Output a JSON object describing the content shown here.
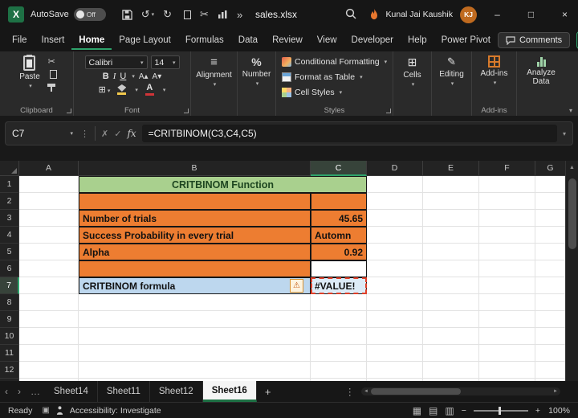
{
  "titlebar": {
    "autosave_label": "AutoSave",
    "autosave_state": "Off",
    "filename": "sales.xlsx",
    "user_name": "Kunal Jai Kaushik",
    "user_initials": "KJ"
  },
  "menubar": {
    "tabs": [
      {
        "label": "File"
      },
      {
        "label": "Insert"
      },
      {
        "label": "Home",
        "active": true
      },
      {
        "label": "Page Layout"
      },
      {
        "label": "Formulas"
      },
      {
        "label": "Data"
      },
      {
        "label": "Review"
      },
      {
        "label": "View"
      },
      {
        "label": "Developer"
      },
      {
        "label": "Help"
      },
      {
        "label": "Power Pivot"
      }
    ],
    "comments_label": "Comments"
  },
  "ribbon": {
    "paste": "Paste",
    "clipboard_group": "Clipboard",
    "font_name": "Calibri",
    "font_size": "14",
    "bold": "B",
    "italic": "I",
    "underline": "U",
    "font_color_letter": "A",
    "font_group": "Font",
    "alignment": "Alignment",
    "number": "Number",
    "conditional_formatting": "Conditional Formatting",
    "format_as_table": "Format as Table",
    "cell_styles": "Cell Styles",
    "styles_group": "Styles",
    "cells": "Cells",
    "editing": "Editing",
    "addins": "Add-ins",
    "addins_group": "Add-ins",
    "analyze_data": "Analyze Data"
  },
  "formula_bar": {
    "name_box": "C7",
    "fx": "fx",
    "formula": "=CRITBINOM(C3,C4,C5)"
  },
  "sheet": {
    "columns": [
      "A",
      "B",
      "C",
      "D",
      "E",
      "F",
      "G"
    ],
    "rows": [
      "1",
      "2",
      "3",
      "4",
      "5",
      "6",
      "7",
      "8",
      "9",
      "10",
      "11",
      "12"
    ],
    "title": "CRITBINOM Function",
    "data": [
      {
        "row": "3",
        "label": "Number of trials",
        "value": "45.65"
      },
      {
        "row": "4",
        "label": "Success Probability in every trial",
        "value": "Automn"
      },
      {
        "row": "5",
        "label": "Alpha",
        "value": "0.92"
      }
    ],
    "result": {
      "row": "7",
      "label": "CRITBINOM formula",
      "value": "#VALUE!"
    },
    "selected_cell": "C7"
  },
  "sheet_tabs": {
    "sheets": [
      {
        "label": "Sheet14"
      },
      {
        "label": "Sheet11"
      },
      {
        "label": "Sheet12"
      },
      {
        "label": "Sheet16",
        "active": true
      }
    ]
  },
  "status_bar": {
    "ready": "Ready",
    "accessibility": "Accessibility: Investigate",
    "zoom": "100%"
  },
  "icons": {
    "caret": "▾",
    "undo": "↺",
    "redo": "↻",
    "cut": "✂",
    "overflow": "»",
    "minimize": "–",
    "maximize": "□",
    "close": "×",
    "menu_dots": "⋮",
    "cancel": "✗",
    "enter": "✓",
    "alignment": "≡",
    "percent": "%",
    "borders": "⊞",
    "pencil": "✎",
    "cells_grid": "⊞",
    "warning": "⚠",
    "ellipsis": "…",
    "nav_left": "‹",
    "nav_right": "›",
    "add_sheet": "+",
    "view_normal": "▦",
    "view_layout": "▤",
    "view_break": "▥",
    "zoom_minus": "−",
    "zoom_plus": "+",
    "scroll_up": "▲",
    "scroll_left": "◄",
    "scroll_right": "►",
    "macro": "▣",
    "font_increase": "A▴",
    "font_decrease": "A▾"
  },
  "colors": {
    "orange": "#ED7D31",
    "green_header": "#A9D08E",
    "blue_label": "#BDD7EE",
    "blue_result": "#DDEBF7",
    "excel_green": "#2EA36B",
    "error_red": "#E0402A"
  }
}
